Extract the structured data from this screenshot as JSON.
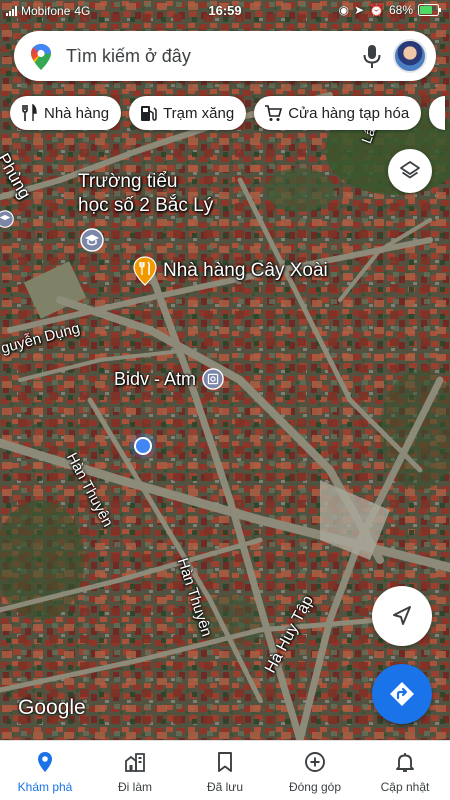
{
  "status_bar": {
    "carrier": "Mobifone",
    "network": "4G",
    "time": "16:59",
    "battery": "68%"
  },
  "search": {
    "placeholder": "Tìm kiếm ở đây"
  },
  "chips": [
    {
      "label": "Nhà hàng",
      "icon": "restaurant-icon"
    },
    {
      "label": "Trạm xăng",
      "icon": "gas-station-icon"
    },
    {
      "label": "Cửa hàng tạp hóa",
      "icon": "shopping-cart-icon"
    }
  ],
  "map": {
    "labels": {
      "school": "Trường tiểu\nhọc số 2 Bắc Lý",
      "restaurant": "Nhà hàng Cây Xoài",
      "bank": "Bidv - Atm",
      "street_phung": "Phùng",
      "street_nguyen_dung": "guyễn Dụng",
      "street_han_thuyen_1": "Hàn Thuyên",
      "street_han_thuyen_2": "Hàn Thuyên",
      "street_ha_huy_tap": "Hà Huy Tập",
      "street_top": "Lâm",
      "street_left_edge": "g"
    },
    "attribution": "Google"
  },
  "bottom_nav": [
    {
      "label": "Khám phá",
      "icon": "explore-pin-icon",
      "active": true
    },
    {
      "label": "Đi làm",
      "icon": "commute-icon",
      "active": false
    },
    {
      "label": "Đã lưu",
      "icon": "bookmark-icon",
      "active": false
    },
    {
      "label": "Đóng góp",
      "icon": "add-circle-icon",
      "active": false
    },
    {
      "label": "Cập nhật",
      "icon": "bell-icon",
      "active": false
    }
  ],
  "colors": {
    "accent": "#1a73e8",
    "location_dot": "#4285f4",
    "poi_orange": "#f29900",
    "poi_blue_grey": "#7b86a8"
  }
}
